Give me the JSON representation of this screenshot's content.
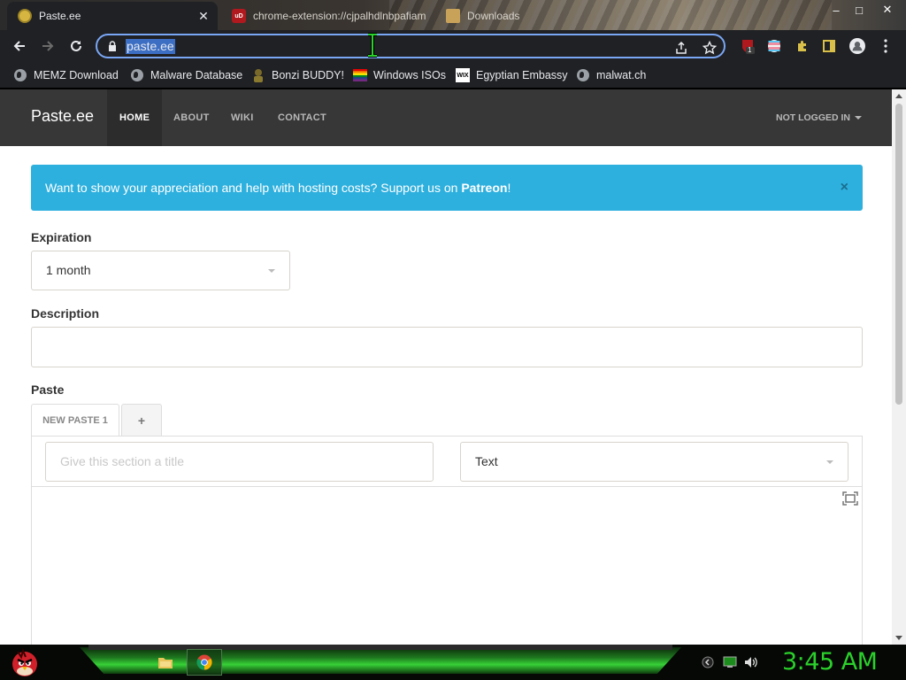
{
  "browser": {
    "tabs": [
      {
        "title": "Paste.ee",
        "close": "✕"
      },
      {
        "title": "chrome-extension://cjpalhdlnbpafiamejdnhcphjbkeiagm/"
      },
      {
        "title": "Downloads"
      }
    ],
    "window_controls": {
      "minimize": "–",
      "maximize": "□",
      "close": "✕"
    },
    "address": "paste.ee",
    "extension_badge": "1",
    "bookmarks": [
      {
        "label": "MEMZ Download",
        "icon": "globe-icon"
      },
      {
        "label": "Malware Database",
        "icon": "globe-icon"
      },
      {
        "label": "Bonzi BUDDY!",
        "icon": "bonzi-icon"
      },
      {
        "label": "Windows ISOs",
        "icon": "rainbow-flag-icon"
      },
      {
        "label": "Egyptian Embassy",
        "icon": "wix-icon",
        "icon_text": "WIX"
      },
      {
        "label": "malwat.ch",
        "icon": "globe-icon"
      }
    ]
  },
  "site": {
    "brand": "Paste.ee",
    "nav": [
      {
        "label": "HOME",
        "active": true
      },
      {
        "label": "ABOUT"
      },
      {
        "label": "WIKI"
      },
      {
        "label": "CONTACT"
      }
    ],
    "user_menu": "NOT LOGGED IN",
    "alert": {
      "text": "Want to show your appreciation and help with hosting costs? Support us on ",
      "link": "Patreon",
      "suffix": "!",
      "close": "×"
    },
    "form": {
      "expiration_label": "Expiration",
      "expiration_value": "1 month",
      "description_label": "Description",
      "description_value": "",
      "paste_label": "Paste",
      "paste_tabs": [
        "NEW PASTE 1"
      ],
      "add_tab": "+",
      "section_title_placeholder": "Give this section a title",
      "syntax_value": "Text"
    }
  },
  "taskbar": {
    "clock": "3:45 AM"
  },
  "colors": {
    "navbar": "#373737",
    "alert": "#2eb0de",
    "clock": "#2bd12b",
    "omnibox_focus": "#7aa7f5"
  }
}
